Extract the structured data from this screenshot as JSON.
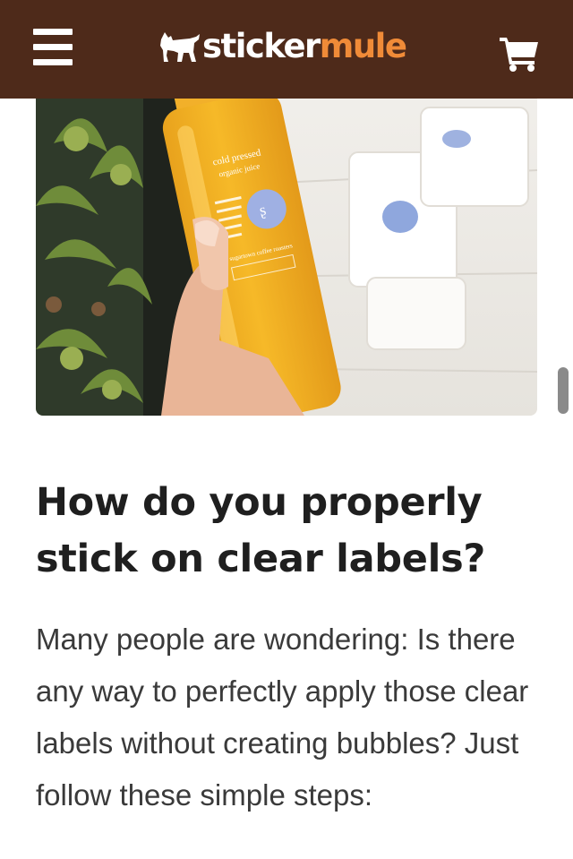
{
  "header": {
    "brand_part1": "sticker",
    "brand_part2": "mule",
    "menu_icon": "hamburger-menu-icon",
    "cart_icon": "shopping-cart-icon",
    "background_color": "#4e2a1a",
    "accent_color": "#f08b38"
  },
  "hero": {
    "bottle_label_lines": [
      "cold pressed",
      "organic juice"
    ],
    "label_footer": "sugartown coffee roasters"
  },
  "article": {
    "title": "How do you properly stick on clear labels?",
    "body": "Many people are wondering: Is there any way to perfectly apply those clear labels without creating bubbles? Just follow these simple steps:"
  }
}
